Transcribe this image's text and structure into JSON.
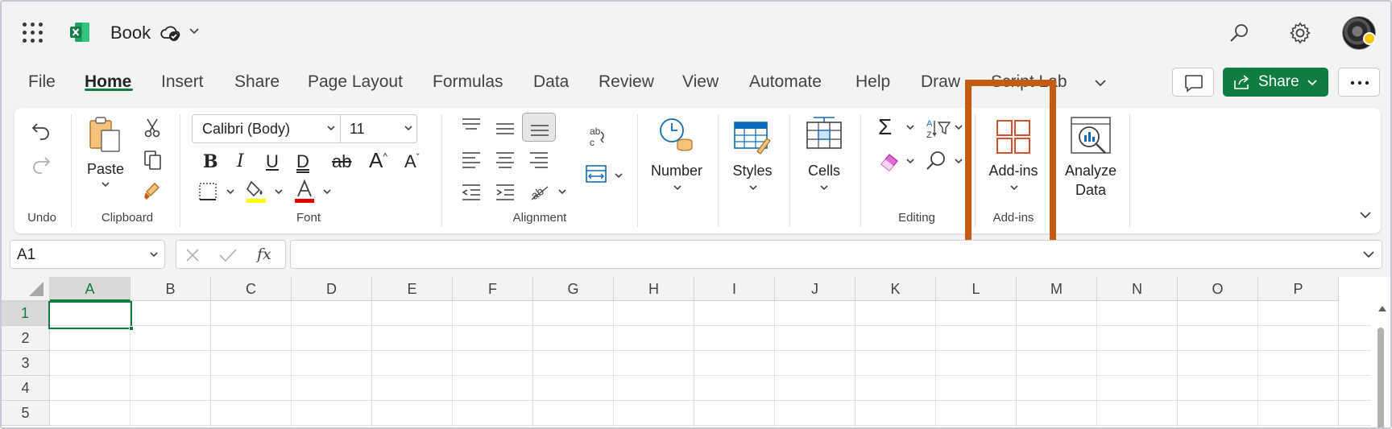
{
  "app": {
    "title": "Book",
    "brand_color": "#107c41",
    "highlight_color": "#c55a11"
  },
  "tabs": [
    {
      "label": "File"
    },
    {
      "label": "Home",
      "active": true
    },
    {
      "label": "Insert"
    },
    {
      "label": "Share"
    },
    {
      "label": "Page Layout"
    },
    {
      "label": "Formulas"
    },
    {
      "label": "Data"
    },
    {
      "label": "Review"
    },
    {
      "label": "View"
    },
    {
      "label": "Automate"
    },
    {
      "label": "Help"
    },
    {
      "label": "Draw"
    },
    {
      "label": "Script Lab"
    }
  ],
  "actions": {
    "share_label": "Share"
  },
  "ribbon": {
    "undo_group": "Undo",
    "clipboard": {
      "paste_label": "Paste",
      "group": "Clipboard"
    },
    "font": {
      "name": "Calibri (Body)",
      "size": "11",
      "group": "Font"
    },
    "alignment": {
      "group": "Alignment"
    },
    "number_label": "Number",
    "styles_label": "Styles",
    "cells_label": "Cells",
    "editing_group": "Editing",
    "addins": {
      "button_label": "Add-ins",
      "group": "Add-ins"
    },
    "analyze": {
      "line1": "Analyze",
      "line2": "Data"
    }
  },
  "formula_bar": {
    "name_box": "A1",
    "fx_label": "fx",
    "formula": ""
  },
  "grid": {
    "columns": [
      "A",
      "B",
      "C",
      "D",
      "E",
      "F",
      "G",
      "H",
      "I",
      "J",
      "K",
      "L",
      "M",
      "N",
      "O",
      "P"
    ],
    "rows": [
      "1",
      "2",
      "3",
      "4",
      "5"
    ],
    "selected_cell": "A1"
  }
}
